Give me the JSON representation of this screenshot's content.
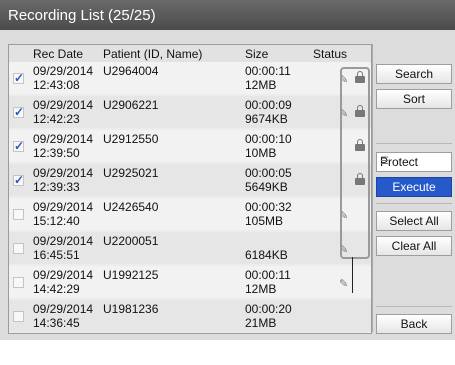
{
  "title": "Recording List  (25/25)",
  "columns": [
    "Rec Date",
    "Patient (ID, Name)",
    "Size",
    "Status"
  ],
  "rows": [
    {
      "date": "09/29/2014",
      "time": "12:43:08",
      "patient": "U2964004",
      "duration": "00:00:11",
      "size": "12MB",
      "checked": true,
      "annotated": true,
      "locked": true
    },
    {
      "date": "09/29/2014",
      "time": "12:42:23",
      "patient": "U2906221",
      "duration": "00:00:09",
      "size": "9674KB",
      "checked": true,
      "annotated": true,
      "locked": true
    },
    {
      "date": "09/29/2014",
      "time": "12:39:50",
      "patient": "U2912550",
      "duration": "00:00:10",
      "size": "10MB",
      "checked": true,
      "annotated": false,
      "locked": true
    },
    {
      "date": "09/29/2014",
      "time": "12:39:33",
      "patient": "U2925021",
      "duration": "00:00:05",
      "size": "5649KB",
      "checked": true,
      "annotated": false,
      "locked": true
    },
    {
      "date": "09/29/2014",
      "time": "15:12:40",
      "patient": "U2426540",
      "duration": "00:00:32",
      "size": "105MB",
      "checked": false,
      "annotated": true,
      "locked": false
    },
    {
      "date": "09/29/2014",
      "time": "16:45:51",
      "patient": "U2200051",
      "duration": "",
      "size": "6184KB",
      "checked": false,
      "annotated": true,
      "locked": false
    },
    {
      "date": "09/29/2014",
      "time": "14:42:29",
      "patient": "U1992125",
      "duration": "00:00:11",
      "size": "12MB",
      "checked": false,
      "annotated": true,
      "locked": false
    },
    {
      "date": "09/29/2014",
      "time": "14:36:45",
      "patient": "U1981236",
      "duration": "00:00:20",
      "size": "21MB",
      "checked": false,
      "annotated": false,
      "locked": false
    }
  ],
  "buttons": {
    "search": "Search",
    "sort": "Sort",
    "protect": "Protect",
    "execute": "Execute",
    "select_all": "Select All",
    "clear_all": "Clear All",
    "back": "Back"
  },
  "colors": {
    "accent": "#2659c9",
    "check": "#2a59c4"
  }
}
